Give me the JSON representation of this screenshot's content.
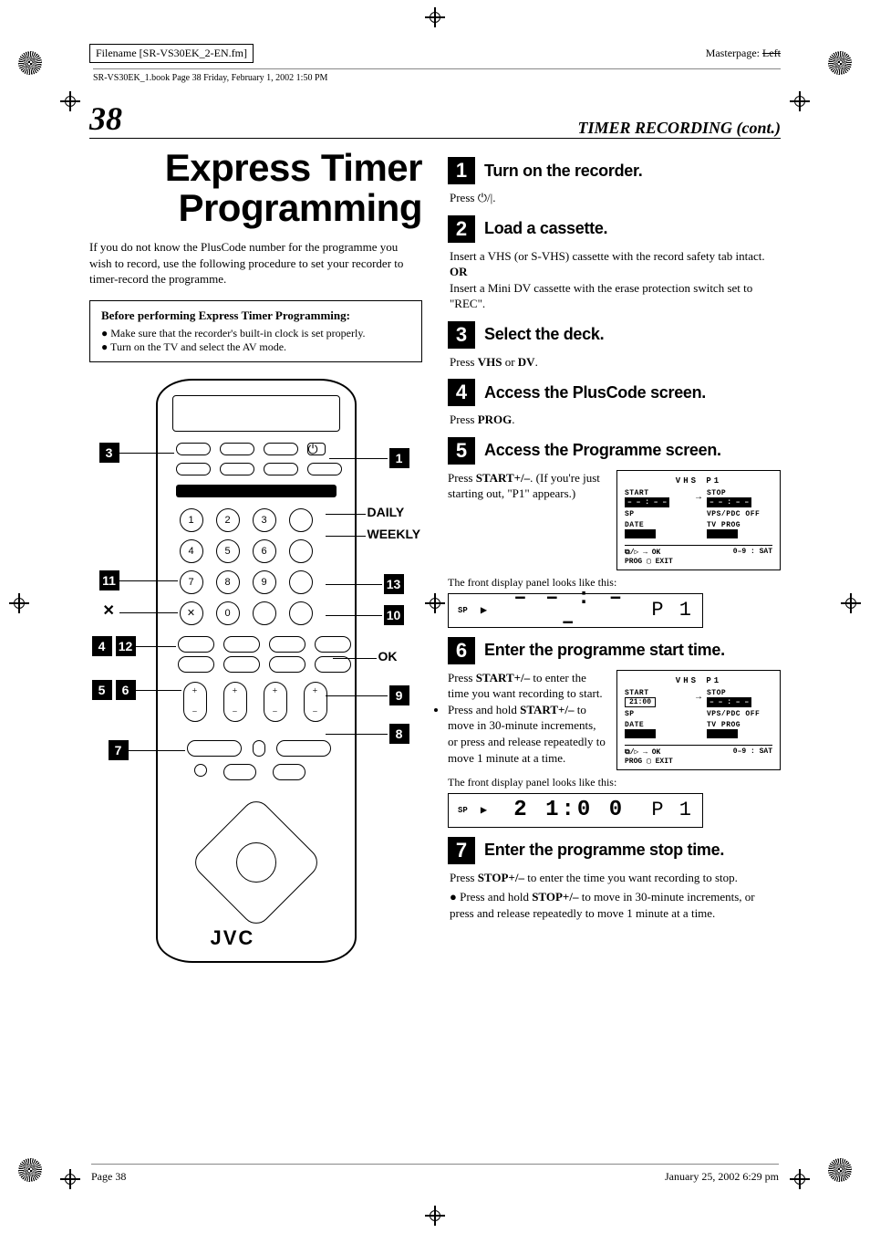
{
  "meta": {
    "filename_label": "Filename [SR-VS30EK_2-EN.fm]",
    "print_line": "SR-VS30EK_1.book  Page 38  Friday, February 1, 2002  1:50 PM",
    "masterpage_label": "Masterpage:",
    "masterpage_value": "Left"
  },
  "header": {
    "page_number": "38",
    "section_title": "TIMER RECORDING (cont.)"
  },
  "left": {
    "title_line1": "Express Timer",
    "title_line2": "Programming",
    "intro": "If you do not know the PlusCode number for the programme you wish to record, use the following procedure to set your recorder to timer-record the programme.",
    "before_title": "Before performing Express Timer Programming:",
    "before_items": [
      "Make sure that the recorder's built-in clock is set properly.",
      "Turn on the TV and select the AV mode."
    ],
    "remote_brand": "JVC",
    "keypad": [
      "1",
      "2",
      "3",
      "4",
      "5",
      "6",
      "7",
      "8",
      "9",
      "0"
    ],
    "callouts_left": {
      "n3": "3",
      "n11": "11",
      "x": "✕",
      "n4": "4",
      "n12": "12",
      "n5": "5",
      "n6": "6",
      "n7": "7"
    },
    "callouts_right": {
      "n1": "1",
      "daily": "DAILY",
      "weekly": "WEEKLY",
      "n13": "13",
      "n10": "10",
      "ok": "OK",
      "n9": "9",
      "n8": "8"
    }
  },
  "steps": {
    "s1": {
      "num": "1",
      "title": "Turn on the recorder.",
      "body_a": "Press ",
      "body_b": "."
    },
    "s2": {
      "num": "2",
      "title": "Load a cassette.",
      "p1": "Insert a VHS (or S-VHS) cassette with the record safety tab intact.",
      "or": "OR",
      "p2": "Insert a Mini DV cassette with the erase protection switch set to \"REC\"."
    },
    "s3": {
      "num": "3",
      "title": "Select the deck.",
      "body_a": "Press ",
      "vhs": "VHS",
      "mid": " or ",
      "dv": "DV",
      "tail": "."
    },
    "s4": {
      "num": "4",
      "title": "Access the PlusCode screen.",
      "body_a": "Press ",
      "prog": "PROG",
      "tail": "."
    },
    "s5": {
      "num": "5",
      "title": "Access the Programme screen.",
      "body_a": "Press ",
      "btn": "START+/–",
      "body_b": ". (If you're just starting out, \"P1\" appears.)",
      "caption": "The front display panel looks like this:",
      "lcd_sp": "SP",
      "lcd_seg": "– – : – –",
      "lcd_p": "P 1"
    },
    "s6": {
      "num": "6",
      "title": "Enter the programme start time.",
      "body_a": "Press ",
      "btn": "START+/–",
      "body_b": " to enter the time you want recording to start.",
      "bullet_a": "Press and hold ",
      "bullet_btn": "START+/–",
      "bullet_b": " to move in 30-minute increments, or press and release repeatedly to move 1 minute at a time.",
      "caption": "The front display panel looks like this:",
      "lcd_sp": "SP",
      "lcd_seg": "2 1:0 0",
      "lcd_p": "P 1"
    },
    "s7": {
      "num": "7",
      "title": "Enter the programme stop time.",
      "body_a": "Press ",
      "btn": "STOP+/–",
      "body_b": " to enter the time you want recording to stop.",
      "bullet_a": "Press and hold ",
      "bullet_btn": "STOP+/–",
      "bullet_b": " to move in 30-minute increments, or press and release repeatedly to move 1 minute at a time."
    }
  },
  "osd5": {
    "top": "VHS   P1",
    "start_lbl": "START",
    "start_val": "– – : – –",
    "stop_lbl": "STOP",
    "stop_val": "– – : – –",
    "sp": "SP",
    "vps": "VPS/PDC OFF",
    "date_lbl": "DATE",
    "date_val": "",
    "tv_lbl": "TV PROG",
    "tv_val": "",
    "bl": "⧉/▷ → OK",
    "bl2": "PROG ▢ EXIT",
    "br": "0–9 : SAT"
  },
  "osd6": {
    "top": "VHS   P1",
    "start_lbl": "START",
    "start_val": "21:00",
    "stop_lbl": "STOP",
    "stop_val": "– – : – –",
    "sp": "SP",
    "vps": "VPS/PDC OFF",
    "date_lbl": "DATE",
    "date_val": "",
    "tv_lbl": "TV PROG",
    "tv_val": "",
    "bl": "⧉/▷ → OK",
    "bl2": "PROG ▢ EXIT",
    "br": "0–9 : SAT"
  },
  "footer": {
    "left": "Page 38",
    "right": "January 25, 2002 6:29 pm"
  }
}
